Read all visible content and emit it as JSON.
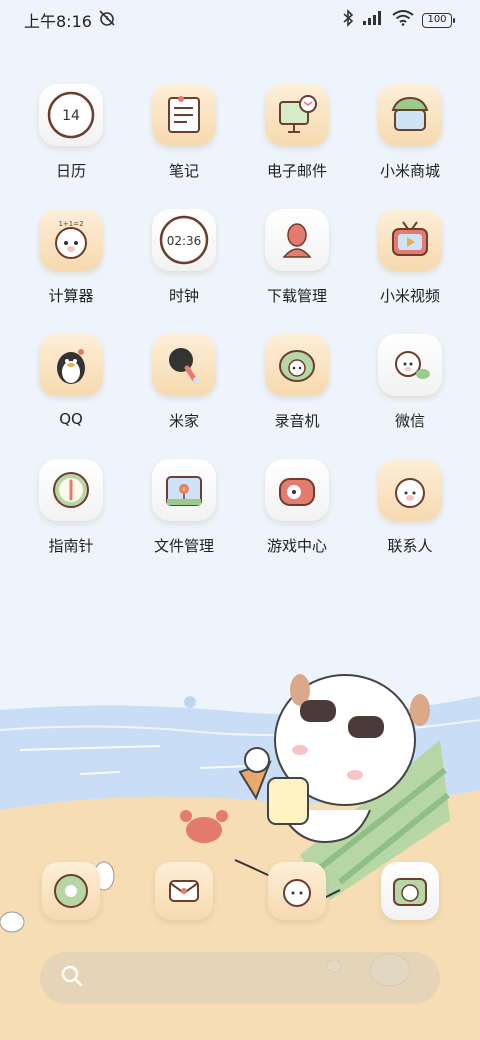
{
  "status_bar": {
    "time": "上午8:16",
    "battery": "100"
  },
  "apps": [
    {
      "label": "日历",
      "icon": "calendar-icon",
      "day": "14"
    },
    {
      "label": "笔记",
      "icon": "notes-icon"
    },
    {
      "label": "电子邮件",
      "icon": "email-icon"
    },
    {
      "label": "小米商城",
      "icon": "mi-store-icon"
    },
    {
      "label": "计算器",
      "icon": "calculator-icon"
    },
    {
      "label": "时钟",
      "icon": "clock-icon",
      "time": "02:36"
    },
    {
      "label": "下载管理",
      "icon": "download-manager-icon"
    },
    {
      "label": "小米视频",
      "icon": "mi-video-icon"
    },
    {
      "label": "QQ",
      "icon": "qq-penguin-icon"
    },
    {
      "label": "米家",
      "icon": "mijia-icon"
    },
    {
      "label": "录音机",
      "icon": "recorder-icon"
    },
    {
      "label": "微信",
      "icon": "wechat-icon"
    },
    {
      "label": "指南针",
      "icon": "compass-icon"
    },
    {
      "label": "文件管理",
      "icon": "file-manager-icon"
    },
    {
      "label": "游戏中心",
      "icon": "game-center-icon"
    },
    {
      "label": "联系人",
      "icon": "contacts-icon"
    }
  ],
  "dock": [
    {
      "icon": "phone-icon"
    },
    {
      "icon": "messages-icon"
    },
    {
      "icon": "browser-icon"
    },
    {
      "icon": "camera-icon"
    }
  ],
  "search": {
    "icon": "search-icon"
  },
  "colors": {
    "background": "#EEF4FB",
    "sea": "#C9DDF6",
    "sand": "#F6DDB4",
    "icon_beige": "#F6D9AE"
  }
}
